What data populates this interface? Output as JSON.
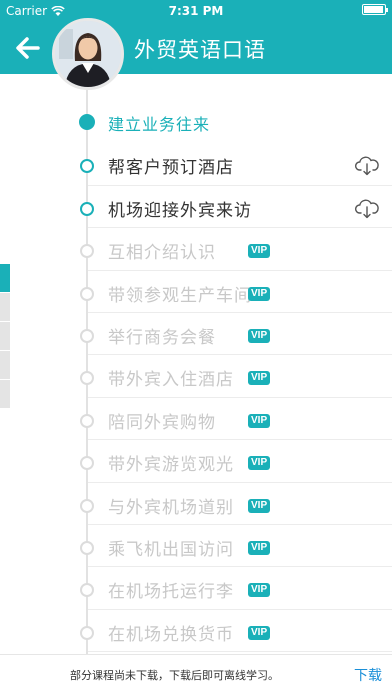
{
  "status_bar": {
    "carrier": "Carrier",
    "time": "7:31 PM"
  },
  "header": {
    "title": "外贸英语口语"
  },
  "side_tabs": {
    "count": 5,
    "active_index": 0
  },
  "lessons": [
    {
      "label": "建立业务往来",
      "kind": "section",
      "vip": false,
      "download": false
    },
    {
      "label": "帮客户预订酒店",
      "kind": "available",
      "vip": false,
      "download": true
    },
    {
      "label": "机场迎接外宾来访",
      "kind": "available",
      "vip": false,
      "download": true
    },
    {
      "label": "互相介绍认识",
      "kind": "locked",
      "vip": true,
      "download": false
    },
    {
      "label": "带领参观生产车间",
      "kind": "locked",
      "vip": true,
      "download": false
    },
    {
      "label": "举行商务会餐",
      "kind": "locked",
      "vip": true,
      "download": false
    },
    {
      "label": "带外宾入住酒店",
      "kind": "locked",
      "vip": true,
      "download": false
    },
    {
      "label": "陪同外宾购物",
      "kind": "locked",
      "vip": true,
      "download": false
    },
    {
      "label": "带外宾游览观光",
      "kind": "locked",
      "vip": true,
      "download": false
    },
    {
      "label": "与外宾机场道别",
      "kind": "locked",
      "vip": true,
      "download": false
    },
    {
      "label": "乘飞机出国访问",
      "kind": "locked",
      "vip": true,
      "download": false
    },
    {
      "label": "在机场托运行李",
      "kind": "locked",
      "vip": true,
      "download": false
    },
    {
      "label": "在机场兑换货币",
      "kind": "locked",
      "vip": true,
      "download": false
    }
  ],
  "vip_label": "VIP",
  "bottom_bar": {
    "message": "部分课程尚未下载，下载后即可离线学习。",
    "download_label": "下载"
  },
  "colors": {
    "accent": "#1ab0b8",
    "locked_text": "#c8c8c8",
    "link": "#1a8fd8"
  }
}
